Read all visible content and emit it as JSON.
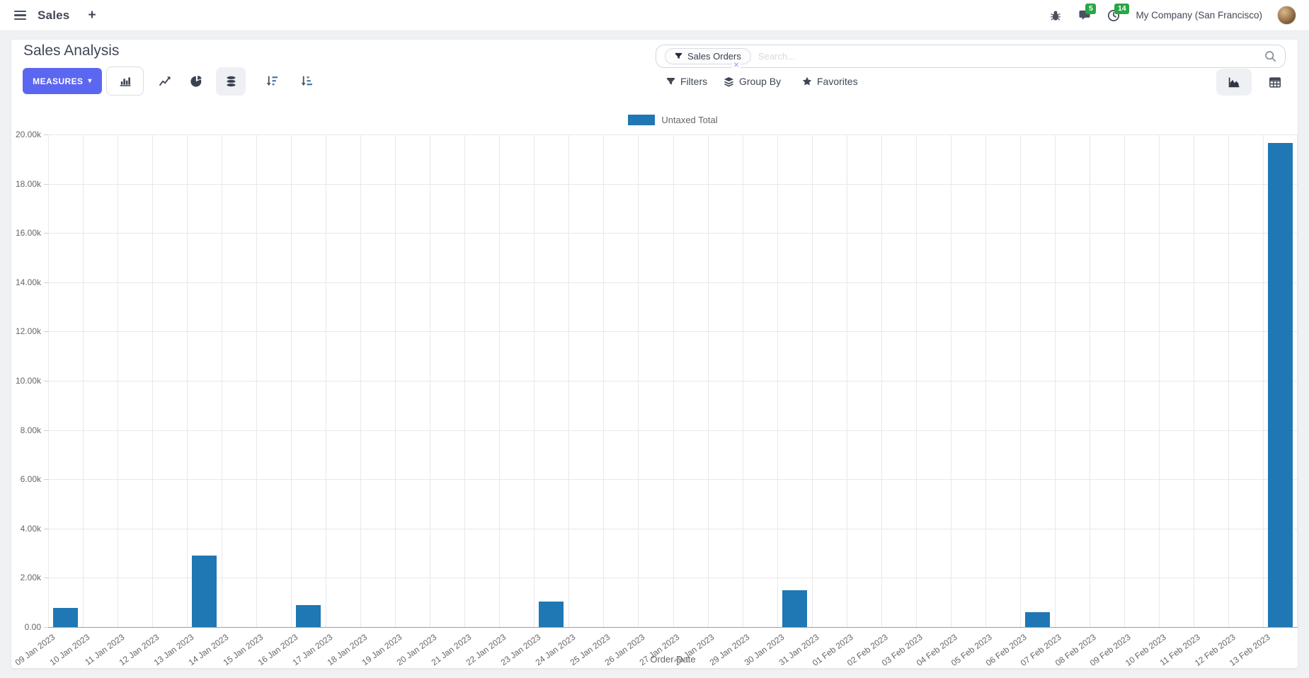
{
  "navbar": {
    "app_menu_label": "Sales",
    "company": "My Company (San Francisco)",
    "messages_badge": "5",
    "activities_badge": "14"
  },
  "header": {
    "title": "Sales Analysis",
    "measures_label": "MEASURES"
  },
  "search": {
    "facet": "Sales Orders",
    "placeholder": "Search...",
    "filters_label": "Filters",
    "group_by_label": "Group By",
    "favorites_label": "Favorites"
  },
  "icons": {
    "caret_down": "▾",
    "close": "×"
  },
  "colors": {
    "accent": "#5b67f0",
    "bar_blue": "#1f77b4",
    "badge_green": "#28a745"
  },
  "chart_data": {
    "type": "bar",
    "title": "",
    "xlabel": "Order Date",
    "ylabel": "",
    "ylim": [
      0,
      20000
    ],
    "grid": true,
    "legend_position": "top-center",
    "y_ticks": [
      "0.00",
      "2.00k",
      "4.00k",
      "6.00k",
      "8.00k",
      "10.00k",
      "12.00k",
      "14.00k",
      "16.00k",
      "18.00k",
      "20.00k"
    ],
    "categories": [
      "09 Jan 2023",
      "10 Jan 2023",
      "11 Jan 2023",
      "12 Jan 2023",
      "13 Jan 2023",
      "14 Jan 2023",
      "15 Jan 2023",
      "16 Jan 2023",
      "17 Jan 2023",
      "18 Jan 2023",
      "19 Jan 2023",
      "20 Jan 2023",
      "21 Jan 2023",
      "22 Jan 2023",
      "23 Jan 2023",
      "24 Jan 2023",
      "25 Jan 2023",
      "26 Jan 2023",
      "27 Jan 2023",
      "28 Jan 2023",
      "29 Jan 2023",
      "30 Jan 2023",
      "31 Jan 2023",
      "01 Feb 2023",
      "02 Feb 2023",
      "03 Feb 2023",
      "04 Feb 2023",
      "05 Feb 2023",
      "06 Feb 2023",
      "07 Feb 2023",
      "08 Feb 2023",
      "09 Feb 2023",
      "10 Feb 2023",
      "11 Feb 2023",
      "12 Feb 2023",
      "13 Feb 2023"
    ],
    "series": [
      {
        "name": "Untaxed Total",
        "color": "#1f77b4",
        "values": [
          780,
          0,
          0,
          0,
          2900,
          0,
          0,
          900,
          0,
          0,
          0,
          0,
          0,
          0,
          1040,
          0,
          0,
          0,
          0,
          0,
          0,
          1500,
          0,
          0,
          0,
          0,
          0,
          0,
          600,
          0,
          0,
          0,
          0,
          0,
          0,
          19650
        ]
      }
    ]
  }
}
